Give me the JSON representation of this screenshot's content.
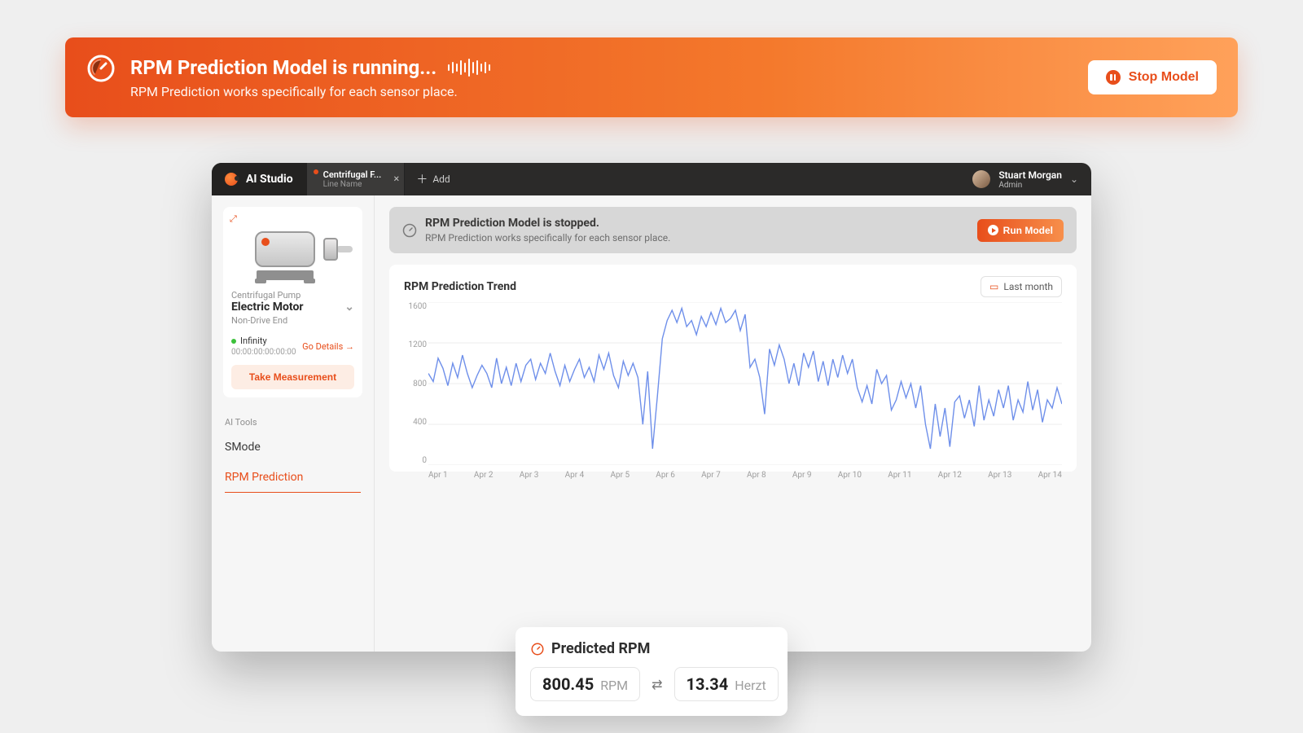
{
  "banner": {
    "title": "RPM Prediction Model is running...",
    "subtitle": "RPM Prediction works specifically for each sensor place.",
    "stop_label": "Stop Model"
  },
  "titlebar": {
    "app_name": "AI Studio",
    "tab": {
      "name": "Centrifugal F...",
      "sub": "Line Name"
    },
    "add_label": "Add",
    "user": {
      "name": "Stuart Morgan",
      "role": "Admin"
    }
  },
  "sidebar": {
    "asset_group": "Centrifugal Pump",
    "asset_selected": "Electric Motor",
    "asset_end": "Non-Drive End",
    "status_label": "Infinity",
    "timestamp": "00:00:00:00:00:00",
    "go_details": "Go Details →",
    "take_measurement": "Take Measurement",
    "tools_header": "AI Tools",
    "tools": [
      {
        "label": "SMode",
        "active": false
      },
      {
        "label": "RPM Prediction",
        "active": true
      }
    ]
  },
  "main": {
    "notice_title": "RPM Prediction Model is stopped.",
    "notice_sub": "RPM Prediction works specifically for each sensor place.",
    "run_label": "Run Model"
  },
  "chart": {
    "title": "RPM Prediction Trend",
    "chip_label": "Last month"
  },
  "chart_data": {
    "type": "line",
    "title": "RPM Prediction Trend",
    "xlabel": "",
    "ylabel": "",
    "ylim": [
      0,
      1600
    ],
    "x_ticks": [
      "Apr 1",
      "Apr 2",
      "Apr 3",
      "Apr 4",
      "Apr 5",
      "Apr 6",
      "Apr 7",
      "Apr 8",
      "Apr 9",
      "Apr 10",
      "Apr 11",
      "Apr 12",
      "Apr 13",
      "Apr 14"
    ],
    "y_ticks": [
      0,
      400,
      800,
      1200,
      1600
    ],
    "series": [
      {
        "name": "RPM",
        "x": [
          1.0,
          1.1,
          1.2,
          1.3,
          1.4,
          1.5,
          1.6,
          1.7,
          1.8,
          1.9,
          2.0,
          2.1,
          2.2,
          2.3,
          2.4,
          2.5,
          2.6,
          2.7,
          2.8,
          2.9,
          3.0,
          3.1,
          3.2,
          3.3,
          3.4,
          3.5,
          3.6,
          3.7,
          3.8,
          3.9,
          4.0,
          4.1,
          4.2,
          4.3,
          4.4,
          4.5,
          4.6,
          4.7,
          4.8,
          4.9,
          5.0,
          5.1,
          5.2,
          5.3,
          5.4,
          5.5,
          5.6,
          5.7,
          5.8,
          5.9,
          6.0,
          6.1,
          6.2,
          6.3,
          6.4,
          6.5,
          6.6,
          6.7,
          6.8,
          6.9,
          7.0,
          7.1,
          7.2,
          7.3,
          7.4,
          7.5,
          7.6,
          7.7,
          7.8,
          7.9,
          8.0,
          8.1,
          8.2,
          8.3,
          8.4,
          8.5,
          8.6,
          8.7,
          8.8,
          8.9,
          9.0,
          9.1,
          9.2,
          9.3,
          9.4,
          9.5,
          9.6,
          9.7,
          9.8,
          9.9,
          10.0,
          10.1,
          10.2,
          10.3,
          10.4,
          10.5,
          10.6,
          10.7,
          10.8,
          10.9,
          11.0,
          11.1,
          11.2,
          11.3,
          11.4,
          11.5,
          11.6,
          11.7,
          11.8,
          11.9,
          12.0,
          12.1,
          12.2,
          12.3,
          12.4,
          12.5,
          12.6,
          12.7,
          12.8,
          12.9,
          13.0,
          13.1,
          13.2,
          13.3,
          13.4,
          13.5,
          13.6,
          13.7,
          13.8,
          13.9,
          14.0
        ],
        "values": [
          900,
          820,
          1050,
          950,
          780,
          1000,
          860,
          1080,
          900,
          760,
          880,
          980,
          900,
          760,
          1050,
          800,
          960,
          780,
          1000,
          820,
          980,
          1040,
          840,
          1000,
          900,
          1100,
          920,
          780,
          980,
          820,
          940,
          1040,
          860,
          960,
          820,
          1080,
          940,
          1100,
          880,
          760,
          1020,
          880,
          1000,
          860,
          400,
          920,
          160,
          680,
          1240,
          1420,
          1520,
          1400,
          1540,
          1360,
          1420,
          1280,
          1460,
          1360,
          1500,
          1380,
          1540,
          1400,
          1440,
          1520,
          1320,
          1480,
          960,
          1040,
          860,
          500,
          1140,
          980,
          1180,
          1040,
          800,
          1000,
          780,
          1100,
          960,
          1120,
          820,
          1020,
          780,
          1040,
          860,
          1080,
          900,
          1040,
          760,
          620,
          780,
          600,
          940,
          800,
          880,
          540,
          640,
          820,
          660,
          800,
          560,
          780,
          400,
          160,
          600,
          280,
          560,
          180,
          620,
          680,
          460,
          640,
          380,
          780,
          440,
          640,
          480,
          740,
          560,
          780,
          440,
          640,
          520,
          820,
          540,
          740,
          420,
          640,
          560,
          760,
          600
        ]
      }
    ]
  },
  "predicted": {
    "header": "Predicted RPM",
    "rpm_value": "800.45",
    "rpm_unit": "RPM",
    "hz_value": "13.34",
    "hz_unit": "Herzt"
  }
}
